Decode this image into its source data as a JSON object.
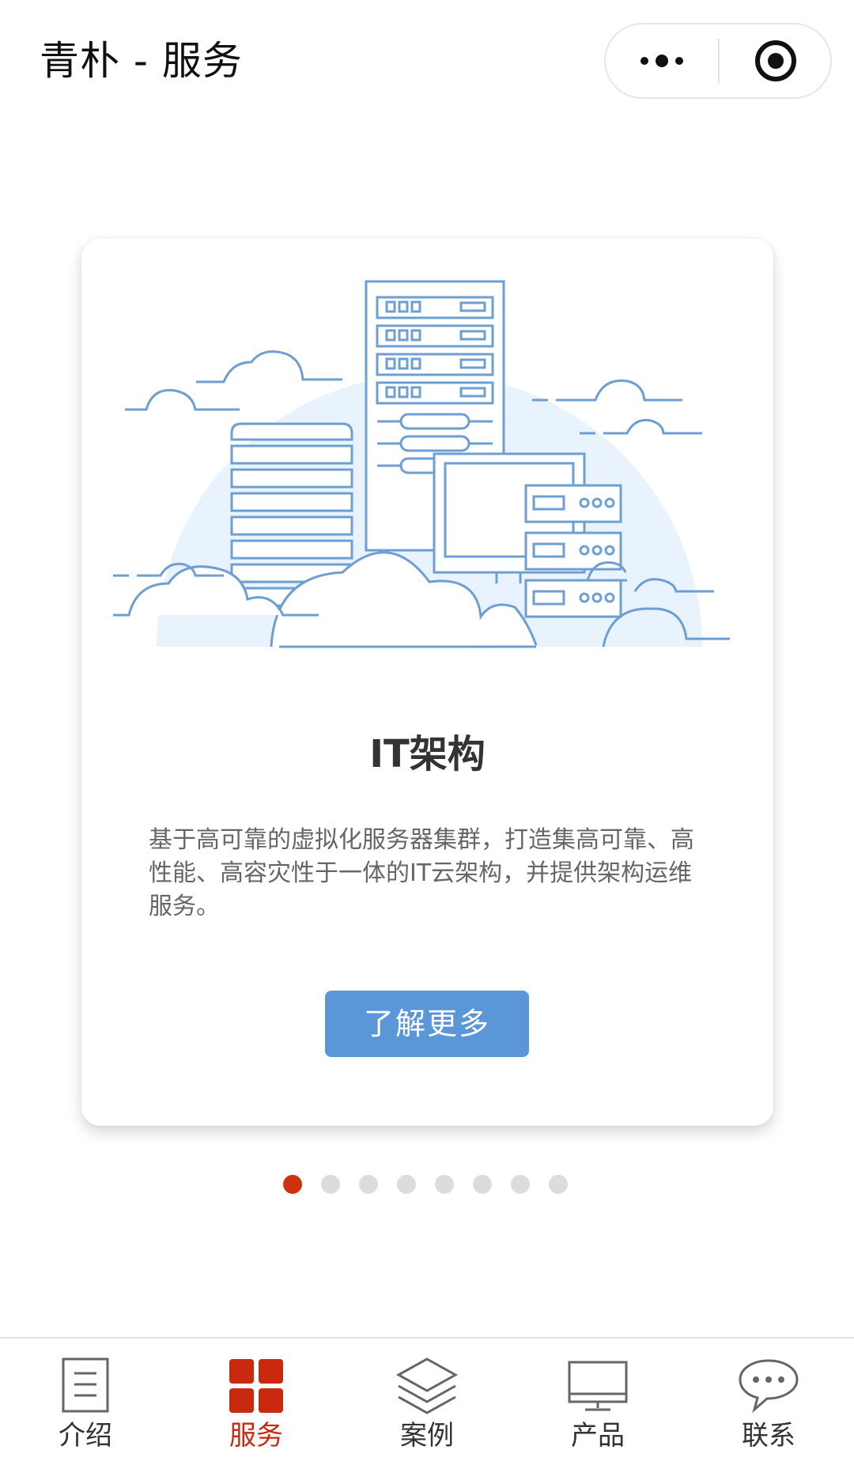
{
  "header": {
    "title": "青朴 - 服务",
    "more_icon": "more-dots-icon",
    "close_icon": "target-circle-icon"
  },
  "card": {
    "illustration": "server-cloud-illustration",
    "title": "IT架构",
    "description": "基于高可靠的虚拟化服务器集群，打造集高可靠、高性能、高容灾性于一体的IT云架构，并提供架构运维服务。",
    "button_label": "了解更多"
  },
  "pager": {
    "count": 8,
    "active_index": 0
  },
  "tabbar": {
    "items": [
      {
        "label": "介绍",
        "icon": "document-icon",
        "active": false
      },
      {
        "label": "服务",
        "icon": "grid-icon",
        "active": true
      },
      {
        "label": "案例",
        "icon": "layers-icon",
        "active": false
      },
      {
        "label": "产品",
        "icon": "monitor-icon",
        "active": false
      },
      {
        "label": "联系",
        "icon": "chat-bubble-icon",
        "active": false
      }
    ]
  },
  "colors": {
    "accent": "#c8290f",
    "button": "#5b96d6",
    "illustration_line": "#6e9fd3",
    "illustration_fill": "#e8f3fd"
  }
}
